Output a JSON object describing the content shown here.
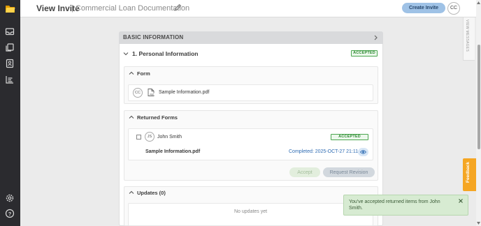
{
  "header": {
    "title": "View Invite",
    "subtitle": "| Commercial Loan Documentation",
    "create_button": "Create Invite",
    "user_initials": "CC"
  },
  "side_panel": {
    "view_messages": "VIEW MESSAGES",
    "feedback": "Feedback"
  },
  "card": {
    "header": "BASIC INFORMATION",
    "section_title": "1. Personal Information",
    "section_status": "ACCEPTED",
    "form": {
      "title": "Form",
      "owner_initials": "CC",
      "file_name": "Sample Information.pdf"
    },
    "returned_forms": {
      "title": "Returned Forms",
      "user_initials": "JS",
      "user_name": "John Smith",
      "status": "ACCEPTED",
      "file_name": "Sample Information.pdf",
      "completed": "Completed: 2025-OCT-27 21:11",
      "accept_label": "Accept",
      "revision_label": "Request Revision"
    },
    "updates": {
      "title": "Updates (0)",
      "empty_text": "No updates yet"
    }
  },
  "toast": {
    "message": "You've accepted returned items from John Smith."
  },
  "colors": {
    "sidebar": "#2b2b2f",
    "accent_logo": "#f5b400",
    "accepted_green": "#2f8a33",
    "link_blue": "#2f6cb3",
    "feedback_orange": "#f5a623",
    "toast_bg": "#d7ebd2"
  },
  "icons": {
    "sidebar": [
      "logo-folder-icon",
      "inbox-icon",
      "copy-icon",
      "contacts-icon",
      "reports-icon",
      "settings-icon",
      "help-icon"
    ],
    "misc": [
      "pencil-icon",
      "chevron-right-icon",
      "chevron-down-icon",
      "chevron-up-icon",
      "pdf-file-icon",
      "eye-icon",
      "close-icon"
    ]
  }
}
